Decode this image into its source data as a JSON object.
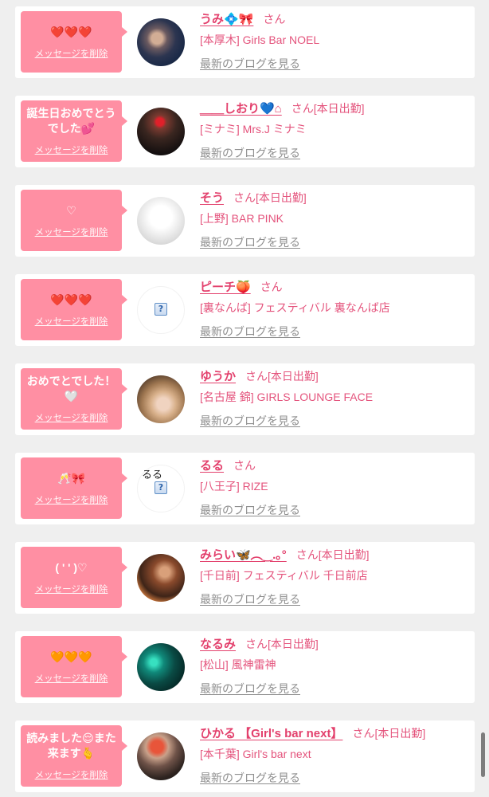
{
  "cards": [
    {
      "message": "❤️❤️❤️",
      "delete_label": "メッセージを削除",
      "name": "うみ💠🎀",
      "honorific": "さん",
      "store": "[本厚木] Girls Bar NOEL",
      "blog_label": "最新のブログを見る"
    },
    {
      "message": "誕生日おめでとうでした💕",
      "delete_label": "メッセージを削除",
      "name": "＿＿しおり💙⌂",
      "honorific": "さん",
      "status": "[本日出勤]",
      "store": "[ミナミ] Mrs.J ミナミ",
      "blog_label": "最新のブログを見る"
    },
    {
      "message": "♡",
      "delete_label": "メッセージを削除",
      "name": "そう",
      "honorific": "さん",
      "status": "[本日出勤]",
      "store": "[上野] BAR PINK",
      "blog_label": "最新のブログを見る"
    },
    {
      "message": "❤️❤️❤️",
      "delete_label": "メッセージを削除",
      "name": "ピーチ🍑",
      "honorific": "さん",
      "store": "[裏なんば] フェスティバル 裏なんば店",
      "blog_label": "最新のブログを見る",
      "avatar_icon": "broken-image-icon"
    },
    {
      "message": "おめでとでした！🤍",
      "delete_label": "メッセージを削除",
      "name": "ゆうか",
      "honorific": "さん",
      "status": "[本日出勤]",
      "store": "[名古屋 錦] GIRLS LOUNGE FACE",
      "blog_label": "最新のブログを見る"
    },
    {
      "message": "🥂🎀",
      "delete_label": "メッセージを削除",
      "name": "るる",
      "honorific": "さん",
      "store": "[八王子] RIZE",
      "blog_label": "最新のブログを見る",
      "avatar_alt": "るる",
      "avatar_icon": "broken-image-icon"
    },
    {
      "message": "( ' ' )♡",
      "delete_label": "メッセージを削除",
      "name": "みらい🦋︵‿.｡°",
      "honorific": "さん",
      "status": "[本日出勤]",
      "store": "[千日前] フェスティバル 千日前店",
      "blog_label": "最新のブログを見る"
    },
    {
      "message": "🧡🧡🧡",
      "delete_label": "メッセージを削除",
      "name": "なるみ",
      "honorific": "さん",
      "status": "[本日出勤]",
      "store": "[松山] 風神雷神",
      "blog_label": "最新のブログを見る"
    },
    {
      "message": "読みました😌また来ます🫰",
      "delete_label": "メッセージを削除",
      "name": "ひかる 【Girl's bar next】",
      "honorific": "さん",
      "status": "[本日出勤]",
      "store": "[本千葉] Girl's bar next",
      "blog_label": "最新のブログを見る"
    }
  ],
  "colors": {
    "page_background": "#efefef",
    "card_background": "#ffffff",
    "bubble": "#ff8fa3",
    "name": "#e3416d",
    "store": "#e4537c",
    "blog_link": "#8f8f8f",
    "scrollbar": "#7d7d7d"
  }
}
